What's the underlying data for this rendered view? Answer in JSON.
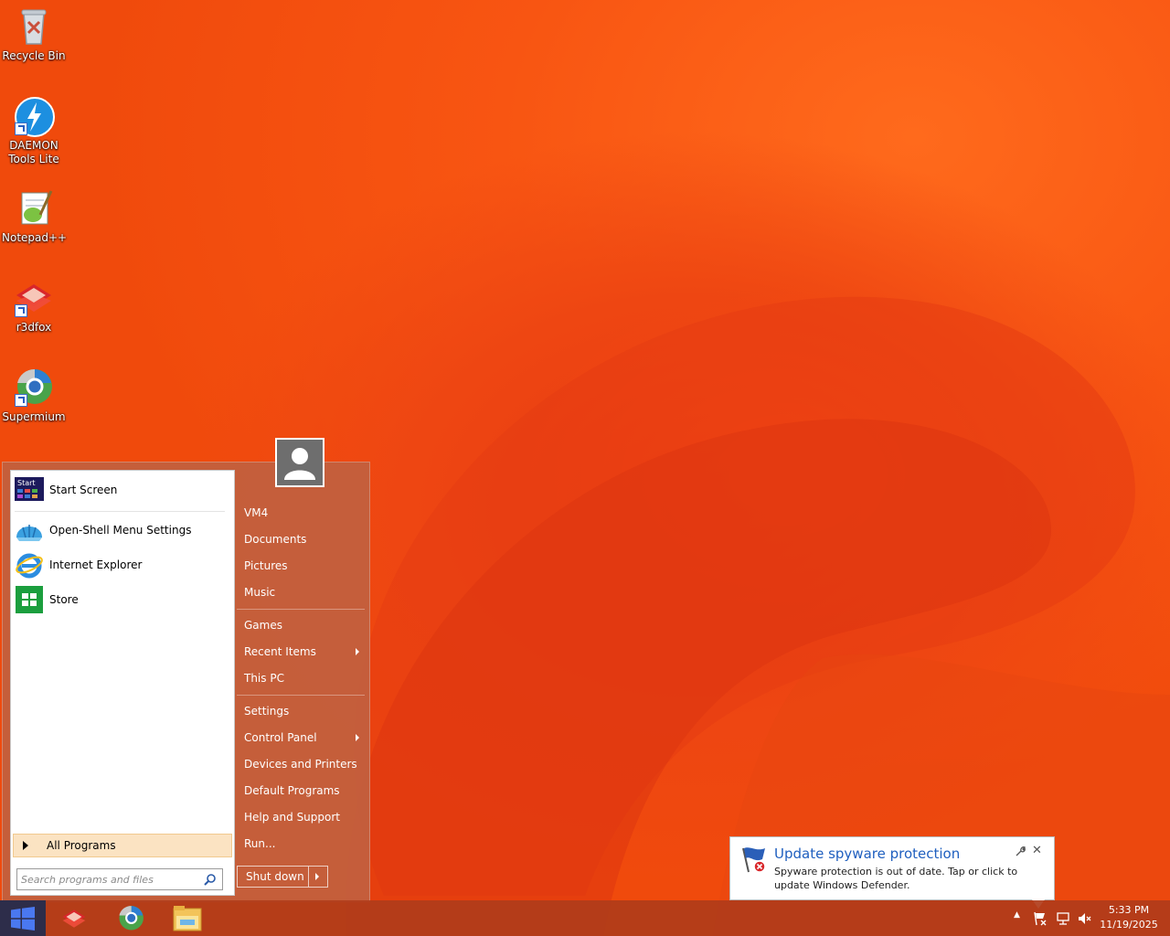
{
  "desktop": {
    "icons": [
      {
        "label": "Recycle Bin"
      },
      {
        "label": "DAEMON Tools Lite"
      },
      {
        "label": "Notepad++"
      },
      {
        "label": "r3dfox"
      },
      {
        "label": "Supermium"
      }
    ]
  },
  "start_menu": {
    "programs": [
      {
        "label": "Start Screen",
        "icon": "start-screen-icon"
      },
      {
        "label": "Open-Shell Menu Settings",
        "icon": "open-shell-icon"
      },
      {
        "label": "Internet Explorer",
        "icon": "internet-explorer-icon"
      },
      {
        "label": "Store",
        "icon": "store-icon"
      }
    ],
    "all_programs_label": "All Programs",
    "search_placeholder": "Search programs and files",
    "right_items": [
      {
        "label": "VM4"
      },
      {
        "label": "Documents"
      },
      {
        "label": "Pictures"
      },
      {
        "label": "Music"
      },
      {
        "label": "Games"
      },
      {
        "label": "Recent Items",
        "submenu": true
      },
      {
        "label": "This PC"
      },
      {
        "label": "Settings"
      },
      {
        "label": "Control Panel",
        "submenu": true
      },
      {
        "label": "Devices and Printers"
      },
      {
        "label": "Default Programs"
      },
      {
        "label": "Help and Support"
      },
      {
        "label": "Run..."
      }
    ],
    "shutdown_label": "Shut down"
  },
  "notification": {
    "title": "Update spyware protection",
    "body": "Spyware protection is out of date. Tap or click to update Windows Defender."
  },
  "taskbar": {
    "pinned": [
      "r3dfox-icon",
      "supermium-icon",
      "file-explorer-icon"
    ],
    "clock_time": "5:33 PM",
    "clock_date": "11/19/2025"
  },
  "colors": {
    "desktop_orange": "#f04a0c",
    "start_menu_bg": "#c2603e",
    "all_programs_highlight": "#fbe3c2",
    "toast_title": "#1f5fbf",
    "start_button": "#2d2d4a"
  }
}
